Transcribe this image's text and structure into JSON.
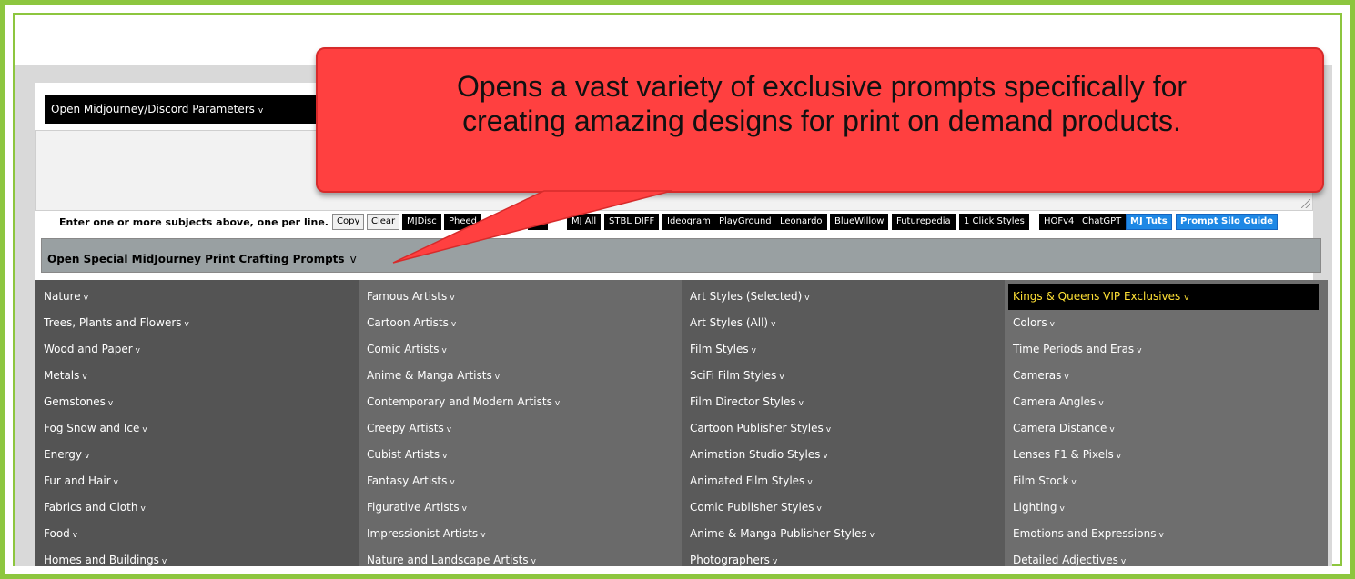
{
  "params_bar": {
    "label": "Open Midjourney/Discord Parameters",
    "chevron": "v"
  },
  "subjects": {
    "value": ""
  },
  "hint": "Enter one or more subjects above, one per line.",
  "buttons": {
    "copy": "Copy",
    "clear": "Clear",
    "mjdisc": "MJDisc",
    "pheedback": "Pheed",
    "hidden": "MJ",
    "mjall": "MJ All",
    "stbl_diff": "STBL DIFF",
    "ideogram": "Ideogram",
    "playground": "PlayGround",
    "leonardo": "Leonardo",
    "bluewillow": "BlueWillow",
    "futurepedia": "Futurepedia",
    "one_click": "1 Click Styles",
    "hofv4": "HOFv4",
    "chatgpt": "ChatGPT",
    "mj_tuts": "MJ Tuts",
    "silo_guide": "Prompt Silo Guide"
  },
  "print_bar": {
    "label": "Open Special MidJourney Print Crafting Prompts",
    "chevron": "v"
  },
  "columns": [
    [
      "Nature",
      "Trees, Plants and Flowers",
      "Wood and Paper",
      "Metals",
      "Gemstones",
      "Fog Snow and Ice",
      "Energy",
      "Fur and Hair",
      "Fabrics and Cloth",
      "Food",
      "Homes and Buildings"
    ],
    [
      "Famous Artists",
      "Cartoon Artists",
      "Comic Artists",
      "Anime & Manga Artists",
      "Contemporary and Modern Artists",
      "Creepy Artists",
      "Cubist Artists",
      "Fantasy Artists",
      "Figurative Artists",
      "Impressionist Artists",
      "Nature and Landscape Artists"
    ],
    [
      "Art Styles (Selected)",
      "Art Styles (All)",
      "Film Styles",
      "SciFi Film Styles",
      "Film Director Styles",
      "Cartoon Publisher Styles",
      "Animation Studio Styles",
      "Animated Film Styles",
      "Comic Publisher Styles",
      "Anime & Manga Publisher Styles",
      "Photographers"
    ],
    [
      "Kings & Queens VIP Exclusives",
      "Colors",
      "Time Periods and Eras",
      "Cameras",
      "Camera Angles",
      "Camera Distance",
      "Lenses F1 & Pixels",
      "Film Stock",
      "Lighting",
      "Emotions and Expressions",
      "Detailed Adjectives"
    ]
  ],
  "chevron": "v",
  "callout": {
    "line1": "Opens a vast variety of exclusive prompts specifically for",
    "line2": "creating amazing designs for print on demand products."
  },
  "colors": {
    "frame_green": "#8dc63f",
    "callout_red": "#ff4040",
    "vip_yellow": "#ffe135",
    "link_blue": "#1e88e5"
  }
}
